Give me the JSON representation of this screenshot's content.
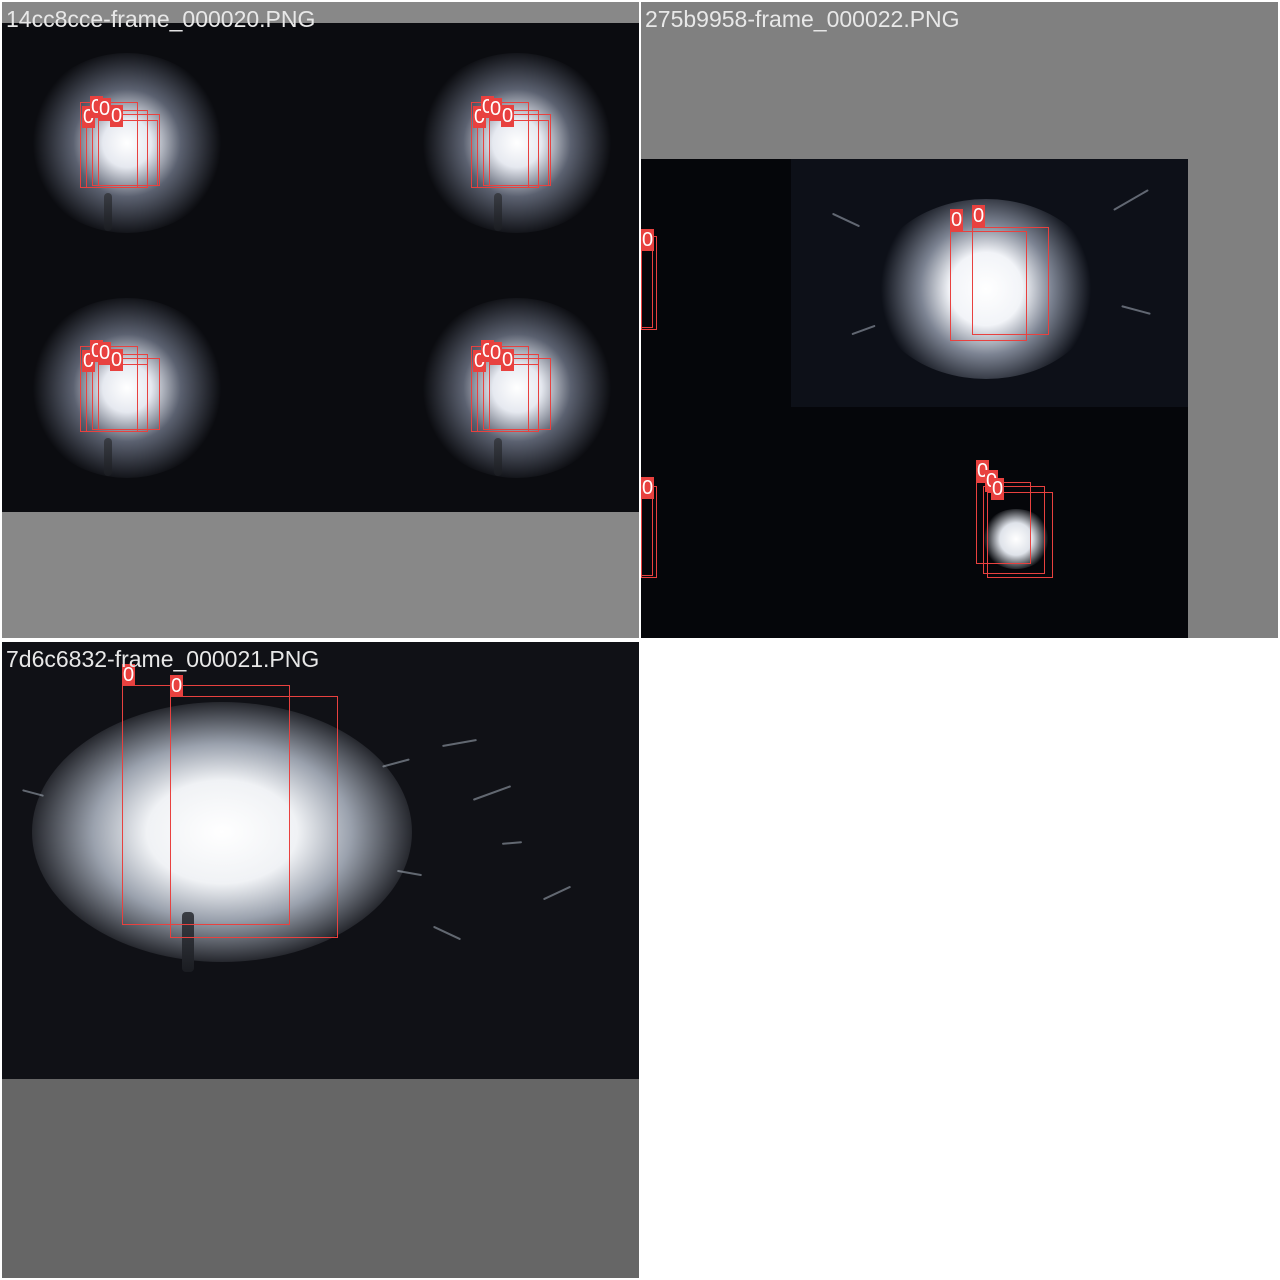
{
  "mosaic": {
    "tiles": [
      {
        "id": "tile-1",
        "filename": "14cc8cce-frame_000020.PNG",
        "detection_label": "0",
        "letterbox_color": "#888888",
        "scene": "four-up welding arc mosaic"
      },
      {
        "id": "tile-2",
        "filename": "275b9958-frame_000022.PNG",
        "detection_label": "0",
        "letterbox_color": "#808080",
        "scene": "welding arc with sparks, two detections"
      },
      {
        "id": "tile-3",
        "filename": "7d6c6832-frame_000021.PNG",
        "detection_label": "0",
        "letterbox_color": "#666666",
        "scene": "close-up welding arc with sparks"
      }
    ],
    "box_color": "#e8413f",
    "background_color": "#ffffff"
  }
}
